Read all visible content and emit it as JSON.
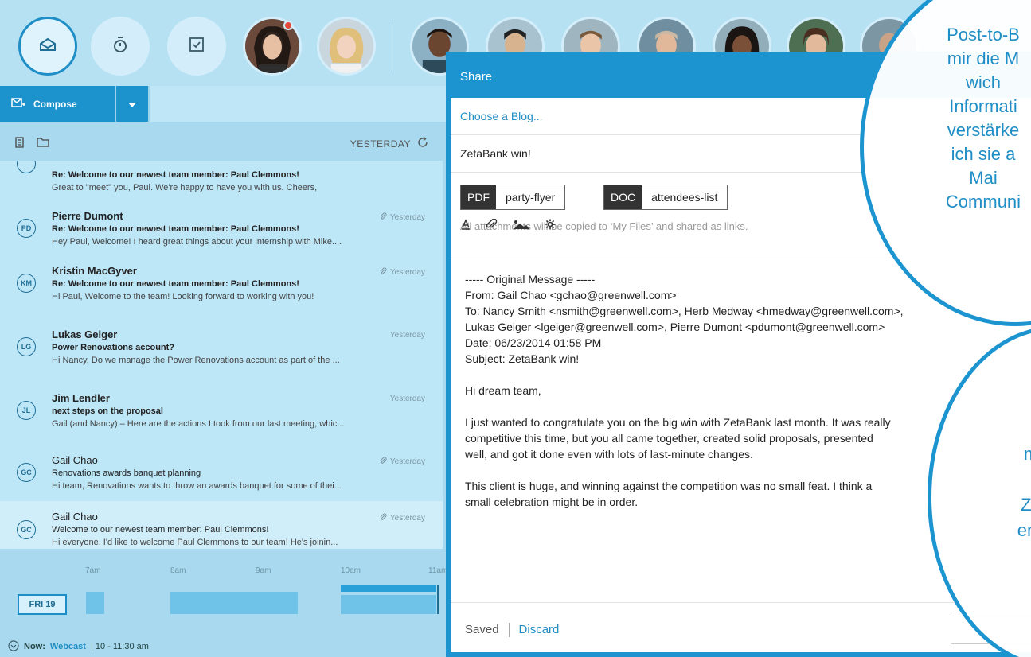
{
  "topbar": {
    "nav": [
      {
        "name": "mail",
        "icon": "envelope-icon"
      },
      {
        "name": "timer",
        "icon": "stopwatch-icon"
      },
      {
        "name": "tasks",
        "icon": "checkbox-icon"
      }
    ]
  },
  "compose": {
    "label": "Compose"
  },
  "list": {
    "day_label": "YESTERDAY",
    "mails": [
      {
        "initials": "",
        "sender": "",
        "subject": "Re: Welcome to our newest team member: Paul Clemmons!",
        "preview": "Great to \"meet\" you, Paul. We're happy to have you with us. Cheers,",
        "date": ""
      },
      {
        "initials": "PD",
        "sender": "Pierre Dumont",
        "subject": "Re: Welcome to our newest team member: Paul Clemmons!",
        "preview": "Hey Paul, Welcome! I heard great things about your internship with Mike....",
        "date": "Yesterday"
      },
      {
        "initials": "KM",
        "sender": "Kristin MacGyver",
        "subject": "Re: Welcome to our newest team member: Paul Clemmons!",
        "preview": "Hi Paul, Welcome to the team! Looking forward to working with you!",
        "date": "Yesterday"
      },
      {
        "initials": "LG",
        "sender": "Lukas Geiger",
        "subject": "Power Renovations account?",
        "preview": "Hi Nancy, Do we manage the Power Renovations account as part of the ...",
        "date": "Yesterday"
      },
      {
        "initials": "JL",
        "sender": "Jim Lendler",
        "subject": "next steps on the proposal",
        "preview": "Gail (and Nancy) – Here are the actions I took from our last meeting, whic...",
        "date": "Yesterday"
      },
      {
        "initials": "GC",
        "sender": "Gail Chao",
        "subject": "Renovations awards banquet planning",
        "preview": "Hi team, Renovations wants to throw an awards banquet for some of thei...",
        "date": "Yesterday"
      },
      {
        "initials": "GC",
        "sender": "Gail Chao",
        "subject": "Welcome to our newest team member: Paul Clemmons!",
        "preview": "Hi everyone, I'd like to welcome Paul Clemmons to our team! He's joinin...",
        "date": "Yesterday"
      }
    ]
  },
  "timeline": {
    "hours": [
      "7am",
      "8am",
      "9am",
      "10am",
      "11am"
    ],
    "day": "FRI 19",
    "now_label": "Now:",
    "now_event": "Webcast",
    "now_time": "| 10 - 11:30 am"
  },
  "share": {
    "title": "Share",
    "blog_placeholder": "Choose a Blog...",
    "subject": "ZetaBank win!",
    "attachments": [
      {
        "type": "PDF",
        "name": "party-flyer"
      },
      {
        "type": "DOC",
        "name": "attendees-list"
      }
    ],
    "attach_note": "All attachments will be copied to ‘My Files’ and shared as links.",
    "body": {
      "orig": "----- Original Message -----",
      "from": "From: Gail Chao <gchao@greenwell.com>",
      "to": "To: Nancy Smith <nsmith@greenwell.com>, Herb Medway <hmedway@greenwell.com>,",
      "to2": "Lukas Geiger <lgeiger@greenwell.com>, Pierre Dumont <pdumont@greenwell.com>",
      "date": "Date:  06/23/2014 01:58 PM",
      "subject": "Subject:  ZetaBank win!",
      "greet": "Hi dream team,",
      "p1a": "I just wanted to congratulate you on the big win with ZetaBank last month. It was really",
      "p1b": "competitive this time, but you all came together, created solid proposals, presented",
      "p1c": "well, and got it done even with lots of last-minute changes.",
      "p2a": "This client is huge, and winning against the competition was no small feat. I think a",
      "p2b": "small celebration might be in order."
    },
    "saved": "Saved",
    "discard": "Discard"
  },
  "callouts": {
    "c1": [
      "Post-to-B",
      "mir die M",
      "wich",
      "Informati",
      "verstärke",
      "ich sie a",
      "Mai",
      "Communi"
    ],
    "c2": [
      "m",
      "Zu",
      "en"
    ]
  },
  "colors": {
    "accent": "#1b94d0",
    "panel": "#a9d9ee"
  }
}
